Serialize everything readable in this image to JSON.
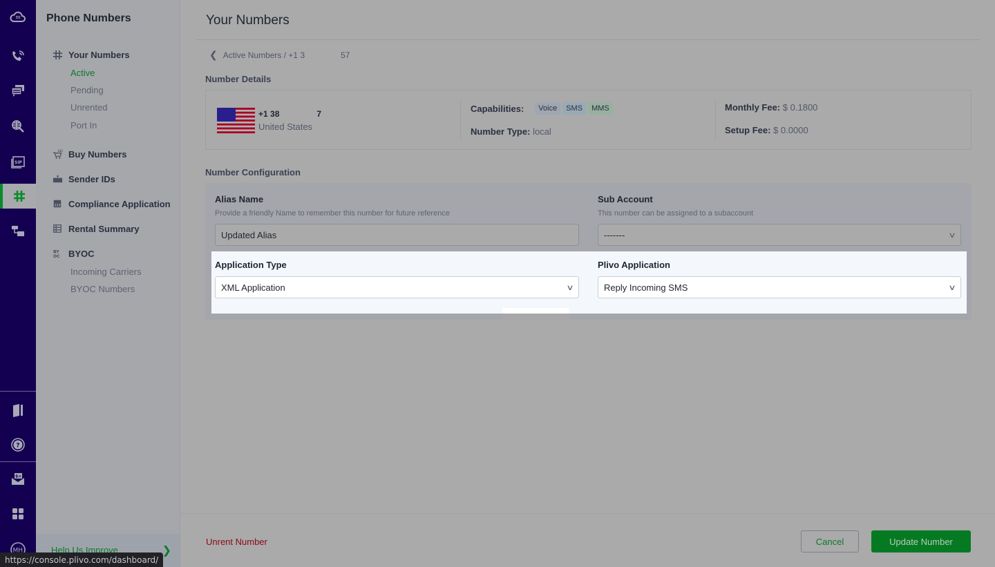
{
  "rail": {
    "items": [
      {
        "name": "dashboard-icon"
      },
      {
        "name": "voice-icon"
      },
      {
        "name": "messaging-icon"
      },
      {
        "name": "lookup-icon"
      },
      {
        "name": "sip-icon"
      },
      {
        "name": "phone-numbers-icon",
        "active": true
      },
      {
        "name": "zentrunk-icon"
      },
      {
        "name": "docs-icon"
      },
      {
        "name": "help-icon"
      },
      {
        "name": "billing-icon"
      },
      {
        "name": "apps-icon"
      },
      {
        "name": "account-avatar",
        "label": "MH"
      }
    ]
  },
  "sidebar": {
    "title": "Phone Numbers",
    "groups": [
      {
        "label": "Your Numbers",
        "icon": "hash-icon",
        "items": [
          "Active",
          "Pending",
          "Unrented",
          "Port In"
        ],
        "active_item": "Active"
      },
      {
        "label": "Buy Numbers",
        "icon": "cart-icon"
      },
      {
        "label": "Sender IDs",
        "icon": "sender-id-icon"
      },
      {
        "label": "Compliance Application",
        "icon": "compliance-icon"
      },
      {
        "label": "Rental Summary",
        "icon": "table-icon"
      },
      {
        "label": "BYOC",
        "icon": "byoc-icon",
        "items": [
          "Incoming Carriers",
          "BYOC Numbers"
        ]
      }
    ],
    "help": {
      "label": "Help Us Improve"
    }
  },
  "header": {
    "title": "Your Numbers",
    "breadcrumb_prefix": "Active Numbers / +1 3",
    "breadcrumb_suffix": "57"
  },
  "number_details": {
    "section_label": "Number Details",
    "number_prefix": "+1 38",
    "number_suffix": "7",
    "country": "United States",
    "capabilities_label": "Capabilities:",
    "capabilities": [
      "Voice",
      "SMS",
      "MMS"
    ],
    "number_type_label": "Number Type:",
    "number_type": "local",
    "monthly_fee_label": "Monthly Fee:",
    "monthly_fee": "$ 0.1800",
    "setup_fee_label": "Setup Fee:",
    "setup_fee": "$ 0.0000"
  },
  "config": {
    "section_label": "Number Configuration",
    "alias": {
      "label": "Alias Name",
      "help": "Provide a friendly Name to remember this number for future reference",
      "value": "Updated Alias"
    },
    "sub_account": {
      "label": "Sub Account",
      "help": "This number can be assigned to a subaccount",
      "value": "-------"
    },
    "application_type": {
      "label": "Application Type",
      "value": "XML Application"
    },
    "plivo_application": {
      "label": "Plivo Application",
      "value": "Reply Incoming SMS"
    }
  },
  "footer": {
    "unrent_label": "Unrent Number",
    "cancel_label": "Cancel",
    "update_label": "Update Number"
  },
  "status_bar": {
    "url": "https://console.plivo.com/dashboard/"
  },
  "colors": {
    "brand_navy": "#140050",
    "accent_green": "#067a22",
    "danger_red": "#8a0a14"
  }
}
